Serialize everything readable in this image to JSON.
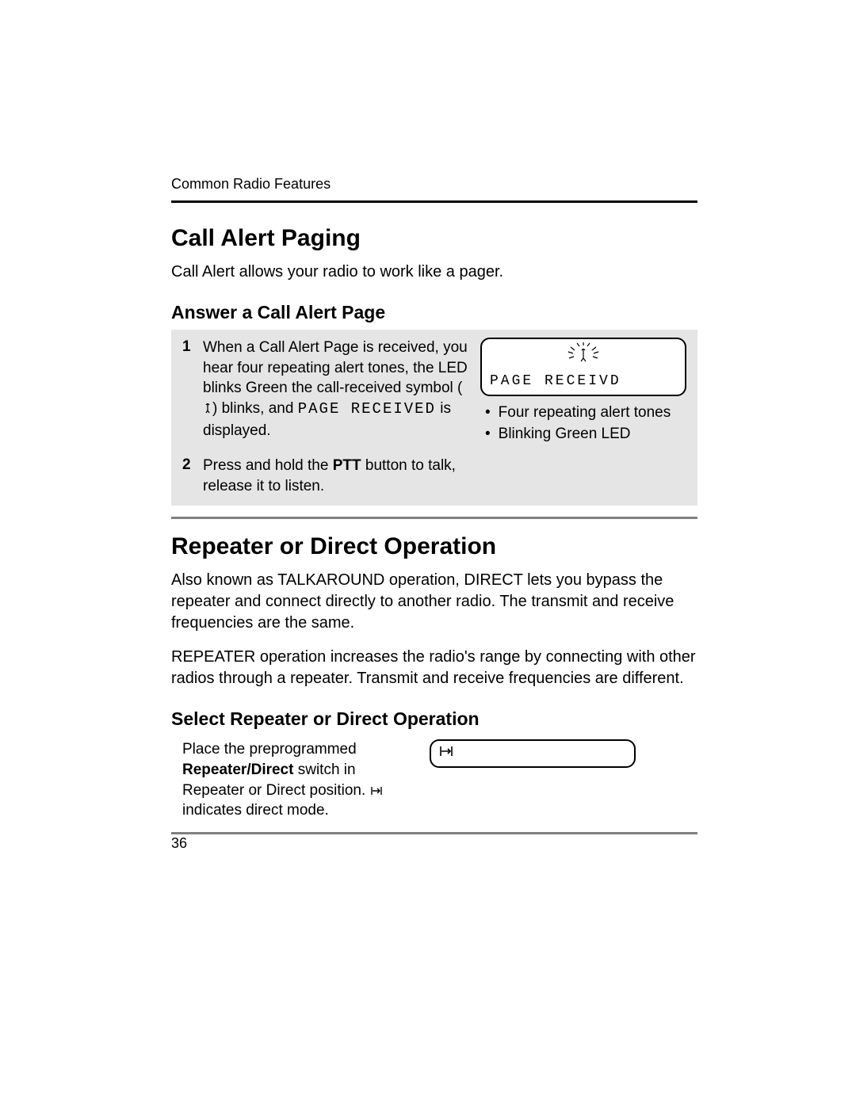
{
  "header": {
    "running": "Common Radio Features"
  },
  "s1": {
    "title": "Call Alert Paging",
    "intro": "Call Alert allows your radio to work like a pager.",
    "sub": "Answer a Call Alert Page",
    "step1": {
      "num": "1",
      "t1": "When a Call Alert Page is received, you hear four repeating alert tones, the LED blinks Green the call-received symbol (",
      "t2": ") blinks, and ",
      "mono": "PAGE RECEIVED",
      "t3": " is displayed."
    },
    "lcd_text": "PAGE RECEIVD",
    "bullet1": "Four repeating alert tones",
    "bullet2": "Blinking Green LED",
    "step2": {
      "num": "2",
      "t1": "Press and hold the ",
      "bold": "PTT",
      "t2": " button to talk, release it to listen."
    }
  },
  "s2": {
    "title": "Repeater or Direct Operation",
    "p1": "Also known as TALKAROUND operation, DIRECT lets you bypass the repeater and connect directly to another radio. The transmit and receive frequencies are the same.",
    "p2": "REPEATER operation increases the radio's range by connecting with other radios through a repeater. Transmit and receive frequencies are different.",
    "sub": "Select Repeater or Direct Operation",
    "step": {
      "t1": "Place the preprogrammed ",
      "bold": "Repeater/Direct",
      "t2": " switch in Repeater or Direct position. ",
      "t3": " indicates direct mode."
    },
    "direct_symbol": "|→|"
  },
  "page_number": "36"
}
